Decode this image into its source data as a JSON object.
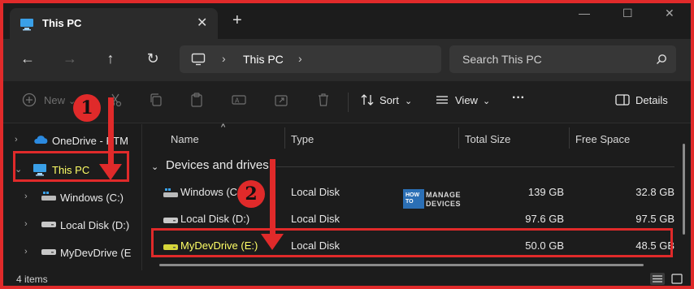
{
  "window": {
    "tab_title": "This PC",
    "new_tab_symbol": "+",
    "close_tab_symbol": "✕",
    "minimize_symbol": "—",
    "maximize_symbol": "☐",
    "close_symbol": "✕"
  },
  "navigation": {
    "back_symbol": "←",
    "forward_symbol": "→",
    "up_symbol": "↑",
    "refresh_symbol": "↻",
    "breadcrumb_separator": "›",
    "breadcrumb_location": "This PC",
    "search_placeholder": "Search This PC"
  },
  "commands": {
    "new_label": "New",
    "sort_label": "Sort",
    "view_label": "View",
    "more_label": "···",
    "details_label": "Details",
    "dropdown_symbol": "⌄"
  },
  "nav_pane": {
    "items": [
      {
        "label": "OneDrive - PTM",
        "icon": "cloud-icon"
      },
      {
        "label": "This PC",
        "icon": "pc-icon",
        "selected": true
      },
      {
        "label": "Windows (C:)",
        "icon": "windows-drive-icon"
      },
      {
        "label": "Local Disk (D:)",
        "icon": "drive-icon"
      },
      {
        "label": "MyDevDrive (E",
        "icon": "drive-icon"
      }
    ],
    "chevron_right": "›",
    "chevron_down": "⌄"
  },
  "columns": {
    "name": "Name",
    "type": "Type",
    "total_size": "Total Size",
    "free_space": "Free Space",
    "sort_caret": "^"
  },
  "group": {
    "label": "Devices and drives",
    "chevron": "⌄"
  },
  "drives": [
    {
      "name": "Windows (C:)",
      "type": "Local Disk",
      "total": "139 GB",
      "free": "32.8 GB",
      "icon": "windows-drive-icon"
    },
    {
      "name": "Local Disk (D:)",
      "type": "Local Disk",
      "total": "97.6 GB",
      "free": "97.5 GB",
      "icon": "drive-icon"
    },
    {
      "name": "MyDevDrive (E:)",
      "type": "Local Disk",
      "total": "50.0 GB",
      "free": "48.5 GB",
      "icon": "drive-icon",
      "highlighted": true
    }
  ],
  "status": {
    "items_count": "4 items"
  },
  "annotations": {
    "step1": "1",
    "step2": "2",
    "accent_color": "#e02a2a"
  },
  "watermark": {
    "how": "HOW TO",
    "line1": "MANAGE",
    "line2": "DEVICES"
  }
}
